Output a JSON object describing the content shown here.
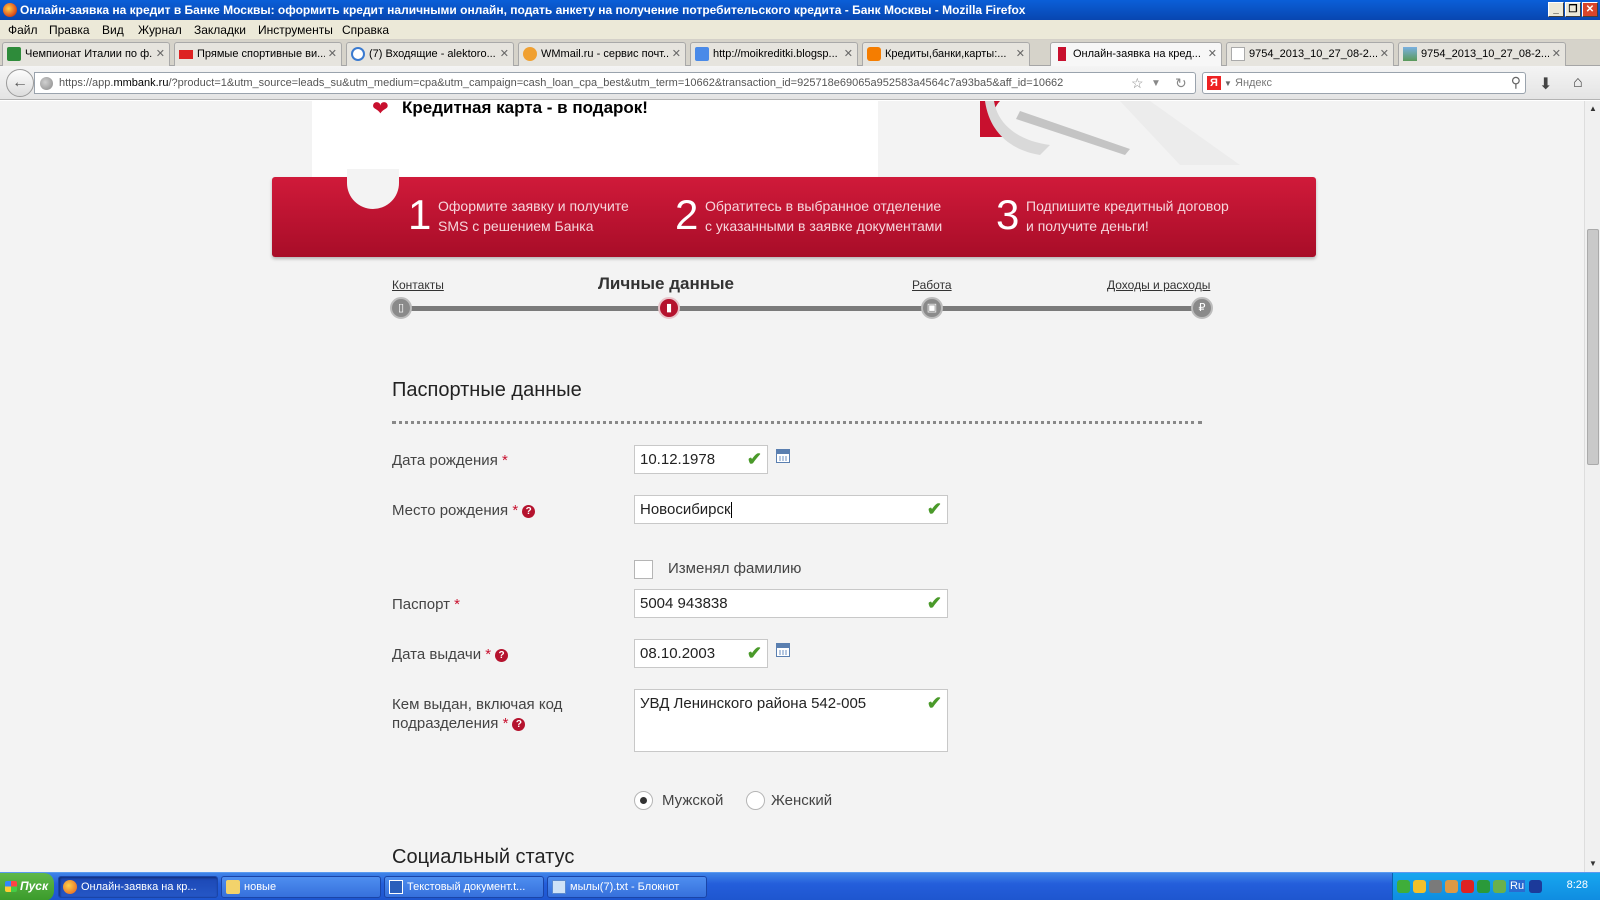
{
  "window": {
    "title": "Онлайн-заявка на кредит в Банке Москвы: оформить кредит наличными онлайн, подать анкету на получение потребительского кредита - Банк Москвы - Mozilla Firefox",
    "controls": [
      "_",
      "❐",
      "✕"
    ]
  },
  "menu": [
    "Файл",
    "Правка",
    "Вид",
    "Журнал",
    "Закладки",
    "Инструменты",
    "Справка"
  ],
  "tabs": [
    {
      "label": "Чемпионат Италии по ф...",
      "icon": "football-icon",
      "color": "#2e8b3a"
    },
    {
      "label": "Прямые спортивные ви...",
      "icon": "live-icon",
      "color": "#d22"
    },
    {
      "label": "(7) Входящие - alektoro...",
      "icon": "mail-icon",
      "color": "#3a7ad0"
    },
    {
      "label": "WMmail.ru - сервис почт...",
      "icon": "wmmail-icon",
      "color": "#f0a030"
    },
    {
      "label": "http://moikreditki.blogsp...",
      "icon": "google-icon",
      "color": "#4a8ae8"
    },
    {
      "label": "Кредиты,банки,карты:...",
      "icon": "blogger-icon",
      "color": "#f57d00"
    },
    {
      "label": "Онлайн-заявка на кред...",
      "icon": "bank-icon",
      "color": "#c8102e",
      "active": true
    },
    {
      "label": "9754_2013_10_27_08-2...",
      "icon": "page-icon",
      "color": "#aaa"
    },
    {
      "label": "9754_2013_10_27_08-2...",
      "icon": "image-icon",
      "color": "#5a9a5a"
    }
  ],
  "tab_close": "✕",
  "new_tab": "+",
  "url": {
    "prefix": "https://app.",
    "domain": "mmbank.ru",
    "rest": "/?product=1&utm_source=leads_su&utm_medium=cpa&utm_campaign=cash_loan_cpa_best&utm_term=10662&transaction_id=925718e69065a952583a4564c7a93ba5&aff_id=10662"
  },
  "search": {
    "placeholder": "Яндекс",
    "engine_letter": "Я"
  },
  "promo": {
    "text_pre": "Кредитная карта - в ",
    "text_bold": "подарок!"
  },
  "steps": [
    {
      "num": "1",
      "line1": "Оформите заявку и получите",
      "line2": "SMS с решением Банка"
    },
    {
      "num": "2",
      "line1": "Обратитесь в выбранное отделение",
      "line2": "с указанными в заявке документами"
    },
    {
      "num": "3",
      "line1": "Подпишите кредитный договор",
      "line2": "и получите деньги!"
    }
  ],
  "progress": [
    {
      "label": "Контакты",
      "icon": "phone-icon"
    },
    {
      "label": "Личные данные",
      "icon": "lock-icon",
      "current": true
    },
    {
      "label": "Работа",
      "icon": "briefcase-icon"
    },
    {
      "label": "Доходы и расходы",
      "icon": "ruble-icon"
    }
  ],
  "section_passport": "Паспортные данные",
  "fields": {
    "birth_date": {
      "label": "Дата рождения",
      "value": "10.12.1978"
    },
    "birth_place": {
      "label": "Место рождения",
      "value": "Новосибирск"
    },
    "changed_name": {
      "label": "Изменял фамилию"
    },
    "passport": {
      "label": "Паспорт",
      "value": "5004 943838"
    },
    "issue_date": {
      "label": "Дата выдачи",
      "value": "08.10.2003"
    },
    "issued_by": {
      "label1": "Кем выдан, включая код",
      "label2": "подразделения",
      "value": "УВД Ленинского района 542-005"
    }
  },
  "required_mark": "*",
  "hint_mark": "?",
  "check_mark": "✔",
  "gender": {
    "male": "Мужской",
    "female": "Женский",
    "selected": "male"
  },
  "section_social": "Социальный статус",
  "taskbar": {
    "start": "Пуск",
    "items": [
      {
        "label": "Онлайн-заявка на кр...",
        "icon": "firefox-icon",
        "active": true
      },
      {
        "label": "новые",
        "icon": "folder-icon"
      },
      {
        "label": "Текстовый документ.t...",
        "icon": "word-icon"
      },
      {
        "label": "мылы(7).txt - Блокнот",
        "icon": "notepad-icon"
      }
    ],
    "lang": "Ru",
    "clock": "8:28"
  },
  "colors": {
    "brand": "#c8102e",
    "ok": "#4a9a2a"
  }
}
